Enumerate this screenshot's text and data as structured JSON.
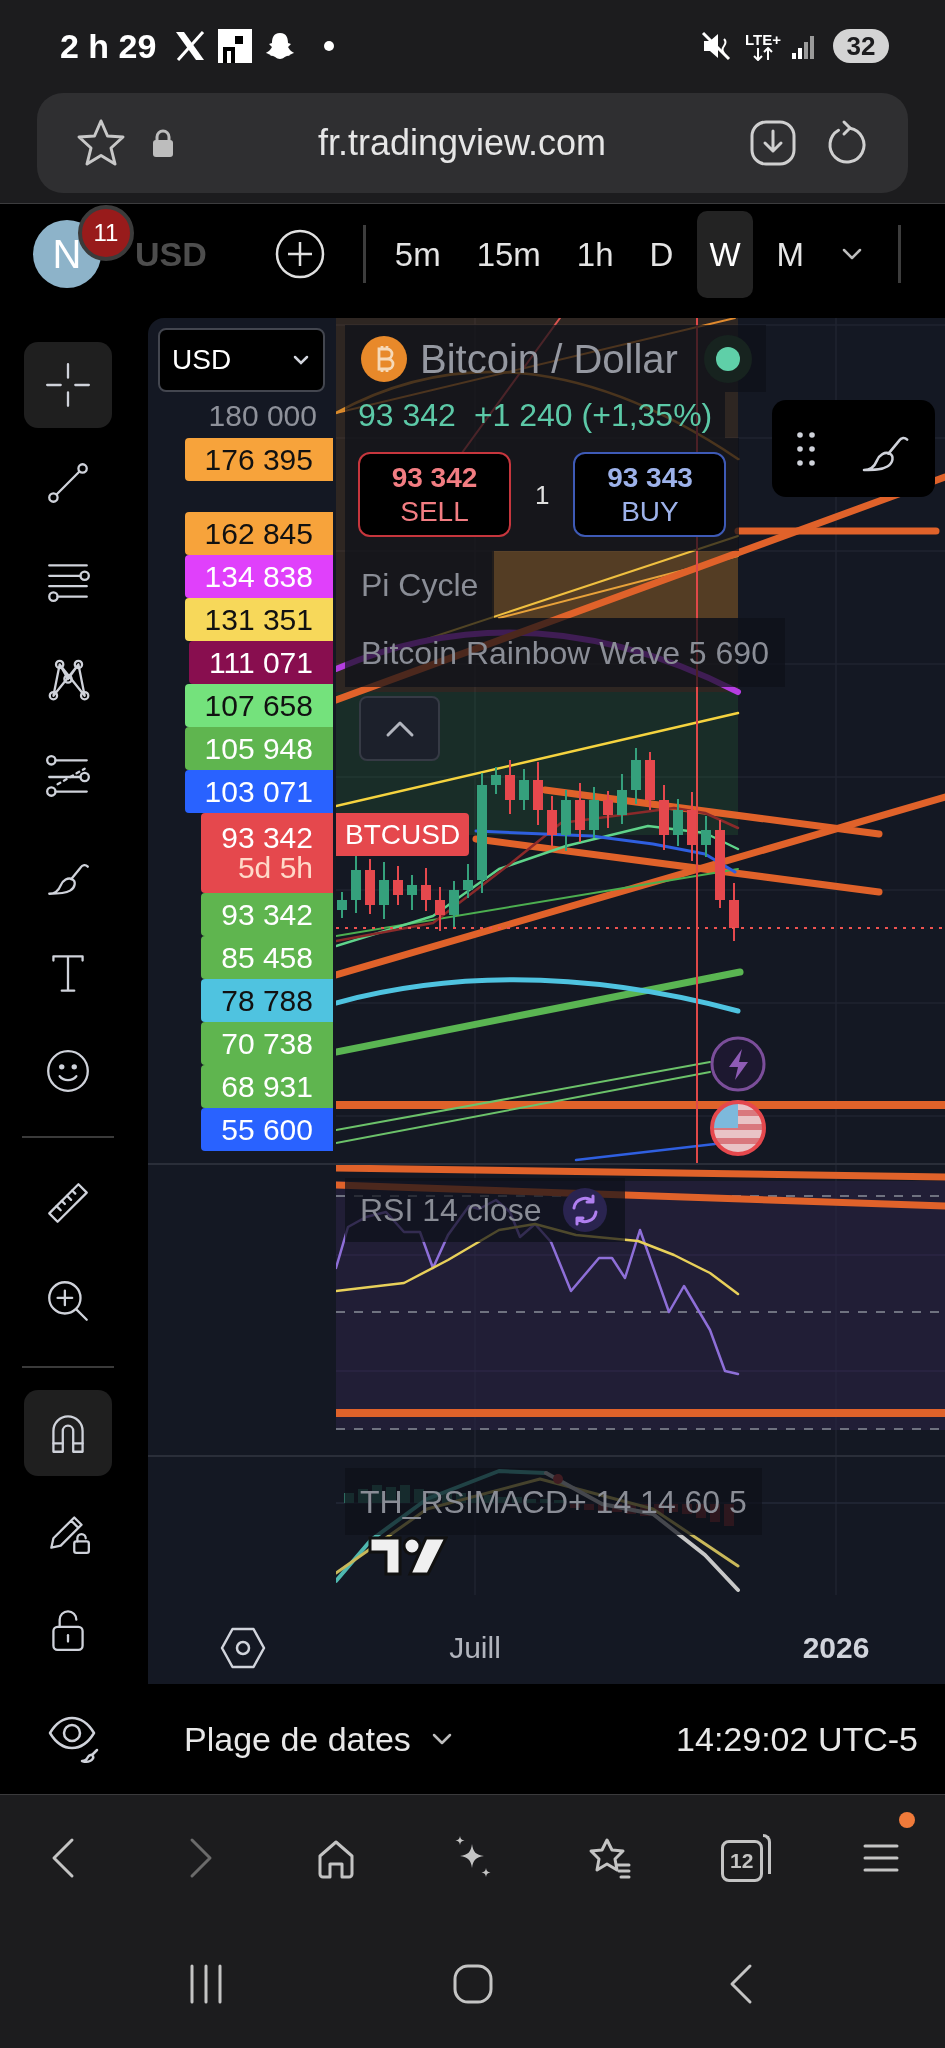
{
  "status_bar": {
    "time": "2 h 29",
    "network_type": "LTE+",
    "battery": "32"
  },
  "browser": {
    "url": "fr.tradingview.com"
  },
  "top_toolbar": {
    "avatar_initial": "N",
    "notification_count": "11",
    "symbol": "USD",
    "intervals": [
      {
        "label": "5m",
        "selected": false
      },
      {
        "label": "15m",
        "selected": false
      },
      {
        "label": "1h",
        "selected": false
      },
      {
        "label": "D",
        "selected": false
      },
      {
        "label": "W",
        "selected": true
      },
      {
        "label": "M",
        "selected": false
      }
    ]
  },
  "drawing_toolbar": {
    "groups": [
      {
        "tools": [
          {
            "kind": "crosshair",
            "selected": true
          },
          {
            "kind": "trendline",
            "selected": false
          },
          {
            "kind": "channel",
            "selected": false
          },
          {
            "kind": "pattern",
            "selected": false
          },
          {
            "kind": "fibonacci",
            "selected": false
          },
          {
            "kind": "brush",
            "selected": false
          },
          {
            "kind": "text",
            "selected": false
          },
          {
            "kind": "emoji",
            "selected": false
          }
        ]
      },
      {
        "tools": [
          {
            "kind": "ruler",
            "selected": false
          },
          {
            "kind": "zoom",
            "selected": false
          }
        ]
      },
      {
        "tools": [
          {
            "kind": "magnet",
            "selected": true
          },
          {
            "kind": "lockdrawing",
            "selected": false
          },
          {
            "kind": "lock",
            "selected": false
          }
        ]
      }
    ]
  },
  "chart": {
    "currency": "USD",
    "axis_top_label": "180 000",
    "price_labels": [
      {
        "value": "176 395",
        "color": "#f7a33b"
      },
      {
        "value": "162 845",
        "color": "#f7a33b"
      },
      {
        "value": "134 838",
        "color": "#e040fb"
      },
      {
        "value": "131 351",
        "color": "#f7d85a"
      },
      {
        "value": "111 071",
        "color": "#880e4f"
      },
      {
        "value": "107 658",
        "color": "#74e27c"
      },
      {
        "value": "105 948",
        "color": "#5fb54f"
      },
      {
        "value": "103 071",
        "color": "#2962ff"
      },
      {
        "value": "93 342",
        "countdown": "5d 5h",
        "color": "#e5484d"
      },
      {
        "value": "93 342",
        "color": "#5fb54f"
      },
      {
        "value": "85 458",
        "color": "#5fb54f"
      },
      {
        "value": "78 788",
        "color": "#4fc3e0"
      },
      {
        "value": "70 738",
        "color": "#5fb54f"
      },
      {
        "value": "68 931",
        "color": "#5fb54f"
      },
      {
        "value": "55 600",
        "color": "#2962ff"
      }
    ],
    "legend": {
      "title": "Bitcoin / Dollar",
      "last_price": "93 342",
      "change": "+1 240 (+1,35%)",
      "sell": {
        "price": "93 342",
        "label": "SELL"
      },
      "quantity": "1",
      "buy": {
        "price": "93 343",
        "label": "BUY"
      },
      "indicators": [
        "Pi Cycle",
        "Bitcoin Rainbow Wave 5 690"
      ]
    },
    "symbol_tag": "BTCUSD"
  },
  "rsi_pane": {
    "legend": "RSI 14 close"
  },
  "macd_pane": {
    "legend": "TH_RSIMACD+ 14 14 60 5"
  },
  "time_axis": {
    "labels": [
      {
        "text": "Juill",
        "kind": "month"
      },
      {
        "text": "2026",
        "kind": "year"
      }
    ]
  },
  "bottom_bar": {
    "date_range": "Plage de dates",
    "clock": "14:29:02 UTC-5"
  },
  "browser_nav": {
    "tab_count": "12",
    "menu_badge": true
  }
}
